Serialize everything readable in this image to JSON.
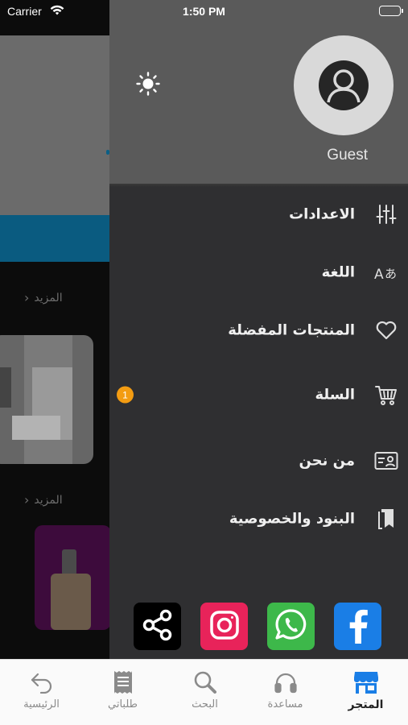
{
  "status_bar": {
    "carrier": "Carrier",
    "time": "1:50 PM"
  },
  "background_page": {
    "section_more_label": "المزيد",
    "section_more_label_2": "المزيد"
  },
  "drawer": {
    "user_name": "Guest",
    "menu_items": [
      {
        "label": "الاعدادات",
        "icon": "settings-sliders-icon"
      },
      {
        "label": "اللغة",
        "icon": "language-icon"
      },
      {
        "label": "المنتجات المفضلة",
        "icon": "heart-icon"
      },
      {
        "label": "السلة",
        "icon": "cart-icon",
        "badge": "1"
      },
      {
        "label": "من نحن",
        "icon": "contact-card-icon"
      },
      {
        "label": "البنود والخصوصية",
        "icon": "book-icon"
      }
    ],
    "social": [
      {
        "name": "facebook",
        "color": "#1a7ee6"
      },
      {
        "name": "whatsapp",
        "color": "#3db84a"
      },
      {
        "name": "instagram",
        "color": "#e8235a"
      },
      {
        "name": "share",
        "color": "#000000"
      }
    ]
  },
  "tab_bar": {
    "tabs": [
      {
        "label": "المتجر",
        "icon": "store-icon",
        "active": true
      },
      {
        "label": "مساعدة",
        "icon": "headphones-icon",
        "active": false
      },
      {
        "label": "البحث",
        "icon": "search-icon",
        "active": false
      },
      {
        "label": "طلباتي",
        "icon": "receipt-icon",
        "active": false
      },
      {
        "label": "الرئيسية",
        "icon": "back-arrow-icon",
        "active": false
      }
    ]
  },
  "colors": {
    "accent_blue": "#1a7ee6",
    "badge_orange": "#f39c12",
    "drawer_bg": "#2f2f31",
    "header_bg": "#5a5a5a"
  }
}
